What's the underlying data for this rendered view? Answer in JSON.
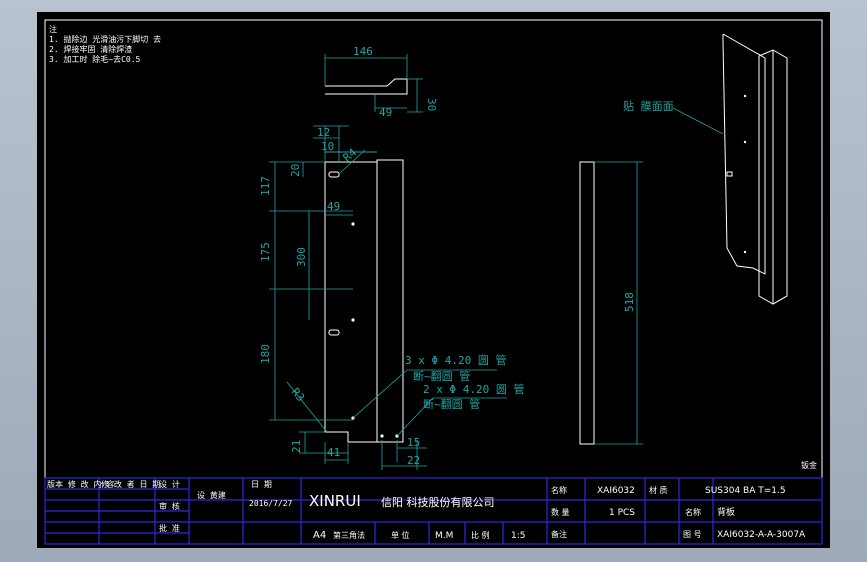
{
  "notes": {
    "heading": "注",
    "line1": "1. 抛除边 光滑油污下脚切 去",
    "line2": "2. 焊接牢固 清除焊渣",
    "line3": "3. 加工时 除毛~去C0.5"
  },
  "dims": {
    "d146": "146",
    "d49_top": "49",
    "d30": "30",
    "d12": "12",
    "d10": "10",
    "dR4": "R4",
    "d20": "20",
    "d117": "117",
    "d49": "49",
    "d300": "300",
    "d175": "175",
    "d180": "180",
    "dR3": "R3",
    "d21": "21",
    "d41": "41",
    "d15": "15",
    "d22": "22",
    "d518": "518"
  },
  "callouts": {
    "hole1": "3 x Φ  4.20 圆 管",
    "hole1_sub": "断~翻圆 管",
    "hole2": "2 x Φ  4.20 圆 管",
    "hole2_sub": "断~翻圆 管",
    "side_label": "贴 膜面面"
  },
  "corner_label": "钣金",
  "title_block": {
    "company_latin": "XINRUI",
    "company_cn": "信阳 科技股份有限公司",
    "date": "2016/7/27",
    "designer": "设 黄建",
    "paper": "A4",
    "angle": "第三角法",
    "unit": "M.M",
    "scale": "1:5",
    "part_no": "XAI6032",
    "material": "SUS304  BA  T=1.5",
    "qty": "1  PCS",
    "part_name": "背板",
    "drawing_no": "XAI6032-A-A-3007A",
    "label_name": "名称",
    "label_material": "材 质",
    "label_qty": "数 量",
    "label_drawing_no": "图 号",
    "label_notes": "备注",
    "label_unit": "单 位",
    "label_scale": "比 例",
    "label_check": "审 核",
    "label_date": "日 期",
    "label_drawn": "设 计",
    "label_approve": "批 准",
    "rev_header1": "版本 修 改 内 容",
    "rev_header2": "修 改 者  日 期"
  }
}
